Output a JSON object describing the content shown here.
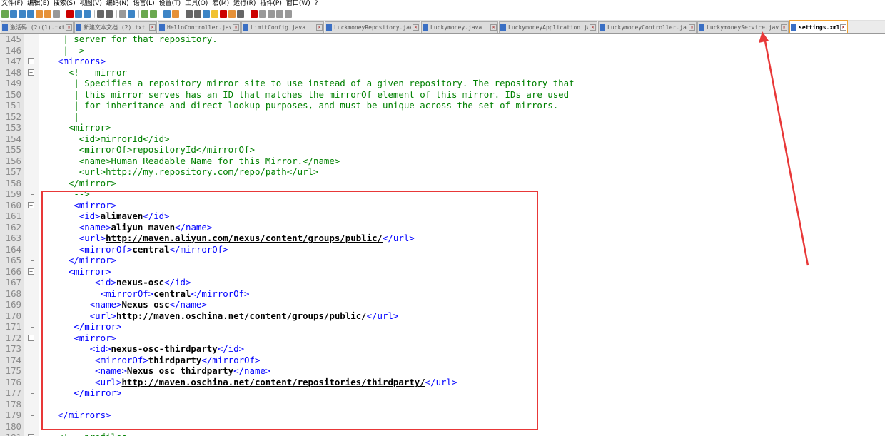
{
  "menu": [
    "文件(F)",
    "编辑(E)",
    "搜索(S)",
    "视图(V)",
    "编码(N)",
    "语言(L)",
    "设置(T)",
    "工具(O)",
    "宏(M)",
    "运行(R)",
    "插件(P)",
    "窗口(W)",
    "?"
  ],
  "tabs": [
    {
      "label": "激活码 (2)(1).txt",
      "active": false
    },
    {
      "label": "新建文本文档 (2).txt",
      "active": false
    },
    {
      "label": "HelloController.java",
      "active": false
    },
    {
      "label": "LimitConfig.java",
      "active": false
    },
    {
      "label": "LuckmoneyRepository.java",
      "active": false
    },
    {
      "label": "Luckymoney.java",
      "active": false
    },
    {
      "label": "LuckymoneyApplication.java",
      "active": false
    },
    {
      "label": "LuckymoneyController.java",
      "active": false
    },
    {
      "label": "LuckymoneyService.java",
      "active": false
    },
    {
      "label": "settings.xml",
      "active": true
    }
  ],
  "colors": {
    "tag": "#0000ff",
    "comment": "#008000",
    "highlight_box": "#e83838",
    "active_tab": "#f0a030"
  },
  "lines": [
    {
      "n": "145",
      "fold": "v",
      "indent": "   ",
      "segs": [
        {
          "k": "c",
          "t": "| server for that repository."
        }
      ]
    },
    {
      "n": "146",
      "fold": "e",
      "indent": "   ",
      "segs": [
        {
          "k": "c",
          "t": "|-->"
        }
      ]
    },
    {
      "n": "147",
      "fold": "m",
      "indent": "  ",
      "segs": [
        {
          "k": "t",
          "t": "<mirrors>"
        }
      ]
    },
    {
      "n": "148",
      "fold": "m",
      "indent": "    ",
      "segs": [
        {
          "k": "c",
          "t": "<!-- mirror"
        }
      ]
    },
    {
      "n": "149",
      "fold": "v",
      "indent": "     ",
      "segs": [
        {
          "k": "c",
          "t": "| Specifies a repository mirror site to use instead of a given repository. The repository that"
        }
      ]
    },
    {
      "n": "150",
      "fold": "v",
      "indent": "     ",
      "segs": [
        {
          "k": "c",
          "t": "| this mirror serves has an ID that matches the mirrorOf element of this mirror. IDs are used"
        }
      ]
    },
    {
      "n": "151",
      "fold": "v",
      "indent": "     ",
      "segs": [
        {
          "k": "c",
          "t": "| for inheritance and direct lookup purposes, and must be unique across the set of mirrors."
        }
      ]
    },
    {
      "n": "152",
      "fold": "v",
      "indent": "     ",
      "segs": [
        {
          "k": "c",
          "t": "|"
        }
      ]
    },
    {
      "n": "153",
      "fold": "v",
      "indent": "    ",
      "segs": [
        {
          "k": "c",
          "t": "<mirror>"
        }
      ]
    },
    {
      "n": "154",
      "fold": "v",
      "indent": "      ",
      "segs": [
        {
          "k": "c",
          "t": "<id>mirrorId</id>"
        }
      ]
    },
    {
      "n": "155",
      "fold": "v",
      "indent": "      ",
      "segs": [
        {
          "k": "c",
          "t": "<mirrorOf>repositoryId</mirrorOf>"
        }
      ]
    },
    {
      "n": "156",
      "fold": "v",
      "indent": "      ",
      "segs": [
        {
          "k": "c",
          "t": "<name>Human Readable Name for this Mirror.</name>"
        }
      ]
    },
    {
      "n": "157",
      "fold": "v",
      "indent": "      ",
      "segs": [
        {
          "k": "c",
          "t": "<url>"
        },
        {
          "k": "cu",
          "t": "http://my.repository.com/repo/path"
        },
        {
          "k": "c",
          "t": "</url>"
        }
      ]
    },
    {
      "n": "158",
      "fold": "v",
      "indent": "    ",
      "segs": [
        {
          "k": "c",
          "t": "</mirror>"
        }
      ]
    },
    {
      "n": "159",
      "fold": "e",
      "indent": "     ",
      "segs": [
        {
          "k": "c",
          "t": "-->"
        }
      ]
    },
    {
      "n": "160",
      "fold": "m",
      "indent": "     ",
      "segs": [
        {
          "k": "t",
          "t": "<mirror>"
        }
      ]
    },
    {
      "n": "161",
      "fold": "v",
      "indent": "      ",
      "segs": [
        {
          "k": "t",
          "t": "<id>"
        },
        {
          "k": "b",
          "t": "alimaven"
        },
        {
          "k": "t",
          "t": "</id>"
        }
      ]
    },
    {
      "n": "162",
      "fold": "v",
      "indent": "      ",
      "segs": [
        {
          "k": "t",
          "t": "<name>"
        },
        {
          "k": "b",
          "t": "aliyun maven"
        },
        {
          "k": "t",
          "t": "</name>"
        }
      ]
    },
    {
      "n": "163",
      "fold": "v",
      "indent": "      ",
      "segs": [
        {
          "k": "t",
          "t": "<url>"
        },
        {
          "k": "u",
          "t": "http://maven.aliyun.com/nexus/content/groups/public/"
        },
        {
          "k": "t",
          "t": "</url>"
        }
      ]
    },
    {
      "n": "164",
      "fold": "v",
      "indent": "      ",
      "segs": [
        {
          "k": "t",
          "t": "<mirrorOf>"
        },
        {
          "k": "b",
          "t": "central"
        },
        {
          "k": "t",
          "t": "</mirrorOf>"
        }
      ]
    },
    {
      "n": "165",
      "fold": "e",
      "indent": "    ",
      "segs": [
        {
          "k": "t",
          "t": "</mirror>"
        }
      ]
    },
    {
      "n": "166",
      "fold": "m",
      "indent": "    ",
      "segs": [
        {
          "k": "t",
          "t": "<mirror>"
        }
      ]
    },
    {
      "n": "167",
      "fold": "v",
      "indent": "         ",
      "segs": [
        {
          "k": "t",
          "t": "<id>"
        },
        {
          "k": "b",
          "t": "nexus-osc"
        },
        {
          "k": "t",
          "t": "</id>"
        }
      ]
    },
    {
      "n": "168",
      "fold": "v",
      "indent": "          ",
      "segs": [
        {
          "k": "t",
          "t": "<mirrorOf>"
        },
        {
          "k": "b",
          "t": "central"
        },
        {
          "k": "t",
          "t": "</mirrorOf>"
        }
      ]
    },
    {
      "n": "169",
      "fold": "v",
      "indent": "        ",
      "segs": [
        {
          "k": "t",
          "t": "<name>"
        },
        {
          "k": "b",
          "t": "Nexus osc"
        },
        {
          "k": "t",
          "t": "</name>"
        }
      ]
    },
    {
      "n": "170",
      "fold": "v",
      "indent": "        ",
      "segs": [
        {
          "k": "t",
          "t": "<url>"
        },
        {
          "k": "u",
          "t": "http://maven.oschina.net/content/groups/public/"
        },
        {
          "k": "t",
          "t": "</url>"
        }
      ]
    },
    {
      "n": "171",
      "fold": "e",
      "indent": "     ",
      "segs": [
        {
          "k": "t",
          "t": "</mirror>"
        }
      ]
    },
    {
      "n": "172",
      "fold": "m",
      "indent": "     ",
      "segs": [
        {
          "k": "t",
          "t": "<mirror>"
        }
      ]
    },
    {
      "n": "173",
      "fold": "v",
      "indent": "        ",
      "segs": [
        {
          "k": "t",
          "t": "<id>"
        },
        {
          "k": "b",
          "t": "nexus-osc-thirdparty"
        },
        {
          "k": "t",
          "t": "</id>"
        }
      ]
    },
    {
      "n": "174",
      "fold": "v",
      "indent": "         ",
      "segs": [
        {
          "k": "t",
          "t": "<mirrorOf>"
        },
        {
          "k": "b",
          "t": "thirdparty"
        },
        {
          "k": "t",
          "t": "</mirrorOf>"
        }
      ]
    },
    {
      "n": "175",
      "fold": "v",
      "indent": "         ",
      "segs": [
        {
          "k": "t",
          "t": "<name>"
        },
        {
          "k": "b",
          "t": "Nexus osc thirdparty"
        },
        {
          "k": "t",
          "t": "</name>"
        }
      ]
    },
    {
      "n": "176",
      "fold": "v",
      "indent": "         ",
      "segs": [
        {
          "k": "t",
          "t": "<url>"
        },
        {
          "k": "u",
          "t": "http://maven.oschina.net/content/repositories/thirdparty/"
        },
        {
          "k": "t",
          "t": "</url>"
        }
      ]
    },
    {
      "n": "177",
      "fold": "e",
      "indent": "     ",
      "segs": [
        {
          "k": "t",
          "t": "</mirror>"
        }
      ]
    },
    {
      "n": "178",
      "fold": "v",
      "indent": "",
      "segs": []
    },
    {
      "n": "179",
      "fold": "e",
      "indent": "  ",
      "segs": [
        {
          "k": "t",
          "t": "</mirrors>"
        }
      ]
    },
    {
      "n": "180",
      "fold": "v",
      "indent": "",
      "segs": []
    },
    {
      "n": "181",
      "fold": "m",
      "indent": "  ",
      "segs": [
        {
          "k": "c",
          "t": "<!-- profiles"
        }
      ]
    }
  ]
}
